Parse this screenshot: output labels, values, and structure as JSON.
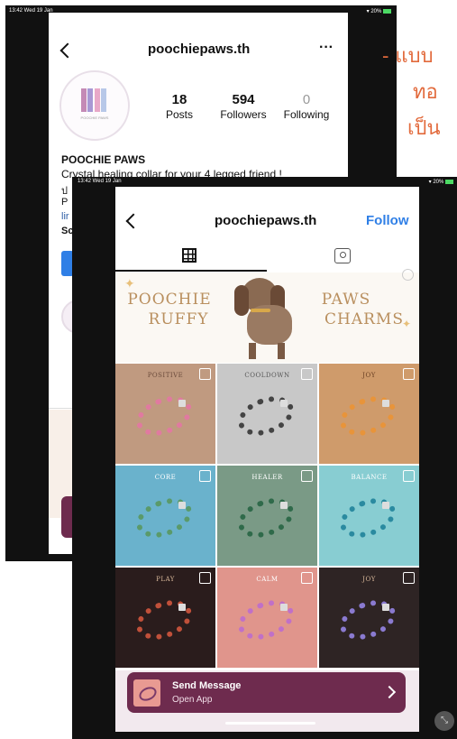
{
  "back": {
    "status_time": "13:42  Wed 19 Jan",
    "status_right": "20%",
    "header_title": "poochiepaws.th",
    "more": "···",
    "logo_text": "POOCHIE PAWS",
    "stats": [
      {
        "num": "18",
        "label": "Posts"
      },
      {
        "num": "594",
        "label": "Followers"
      },
      {
        "num": "0",
        "label": "Following"
      }
    ],
    "profile_name": "POOCHIE PAWS",
    "bio_line": "Crystal healing collar for your 4 legged friend !",
    "bio_fragments": [
      "ป",
      "P",
      "lir",
      "Sc"
    ]
  },
  "handwriting": [
    "- แบบ",
    "ทอ",
    "เป็น"
  ],
  "front": {
    "status_time": "13:42  Wed 19 Jan",
    "status_right": "20%",
    "header_title": "poochiepaws.th",
    "follow_label": "Follow",
    "banner": {
      "left_line1": "POOCHIE",
      "left_line2": "RUFFY",
      "right_line1": "PAWS",
      "right_line2": "CHARMS"
    },
    "grid": [
      {
        "label": "POSITIVE",
        "bg": "#c09a80",
        "text": "#6a4a3a"
      },
      {
        "label": "COOLDOWN",
        "bg": "#c8c8c8",
        "text": "#555555"
      },
      {
        "label": "JOY",
        "bg": "#cf9b6b",
        "text": "#6a4024"
      },
      {
        "label": "CORE",
        "bg": "#6ab2cc",
        "text": "#ffffff"
      },
      {
        "label": "HEALER",
        "bg": "#7a9a86",
        "text": "#ffffff"
      },
      {
        "label": "BALANCE",
        "bg": "#88cdd2",
        "text": "#ffffff"
      },
      {
        "label": "PLAY",
        "bg": "#2a1c1c",
        "text": "#d8b89a"
      },
      {
        "label": "CALM",
        "bg": "#e0958c",
        "text": "#ffffff"
      },
      {
        "label": "JOY",
        "bg": "#2e2424",
        "text": "#d8b89a"
      }
    ],
    "send_message": {
      "title": "Send Message",
      "subtitle": "Open App"
    }
  },
  "colors": {
    "accent_blue": "#2f7fe6",
    "message_bar": "#6e2b4e",
    "handwriting": "#e26a3c"
  }
}
